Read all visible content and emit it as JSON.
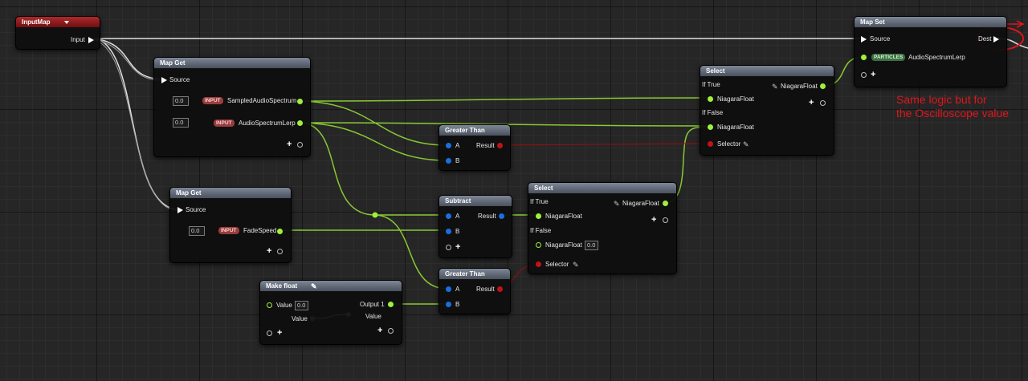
{
  "colors": {
    "float_pin": "#9ff03a",
    "bool_pin": "#c0121a",
    "blue_pin": "#1a6fe0",
    "annotation": "#e0161c"
  },
  "input_map": {
    "title": "InputMap",
    "input_label": "Input"
  },
  "map_get_1": {
    "title": "Map Get",
    "source_label": "Source",
    "rows": [
      {
        "value": "0.0",
        "badge": "INPUT",
        "name": "SampledAudioSpectrum"
      },
      {
        "value": "0.0",
        "badge": "INPUT",
        "name": "AudioSpectrumLerp"
      }
    ]
  },
  "map_get_2": {
    "title": "Map Get",
    "source_label": "Source",
    "row": {
      "value": "0.0",
      "badge": "INPUT",
      "name": "FadeSpeed"
    }
  },
  "greater_than_1": {
    "title": "Greater Than",
    "a": "A",
    "b": "B",
    "result": "Result"
  },
  "greater_than_2": {
    "title": "Greater Than",
    "a": "A",
    "b": "B",
    "result": "Result"
  },
  "subtract": {
    "title": "Subtract",
    "a": "A",
    "b": "B",
    "result": "Result"
  },
  "select_1": {
    "title": "Select",
    "if_true": "If True",
    "if_false": "If False",
    "output": "NiagaraFloat",
    "true_pin": "NiagaraFloat",
    "false_pin": "NiagaraFloat",
    "selector": "Selector"
  },
  "select_2": {
    "title": "Select",
    "if_true": "If True",
    "if_false": "If False",
    "output": "NiagaraFloat",
    "true_pin": "NiagaraFloat",
    "false_pin": "NiagaraFloat",
    "false_value": "0.0",
    "selector": "Selector"
  },
  "make_float": {
    "title": "Make float",
    "value_label": "Value",
    "value": "0.0",
    "output": "Output 1",
    "curve_in_label": "Value",
    "curve_out_label": "Value"
  },
  "map_set": {
    "title": "Map Set",
    "source_label": "Source",
    "dest_label": "Dest",
    "badge": "PARTICLES",
    "attr": "AudioSpectrumLerp"
  },
  "annotation": {
    "line1": "Same logic but for",
    "line2": "the Oscilloscope value"
  }
}
